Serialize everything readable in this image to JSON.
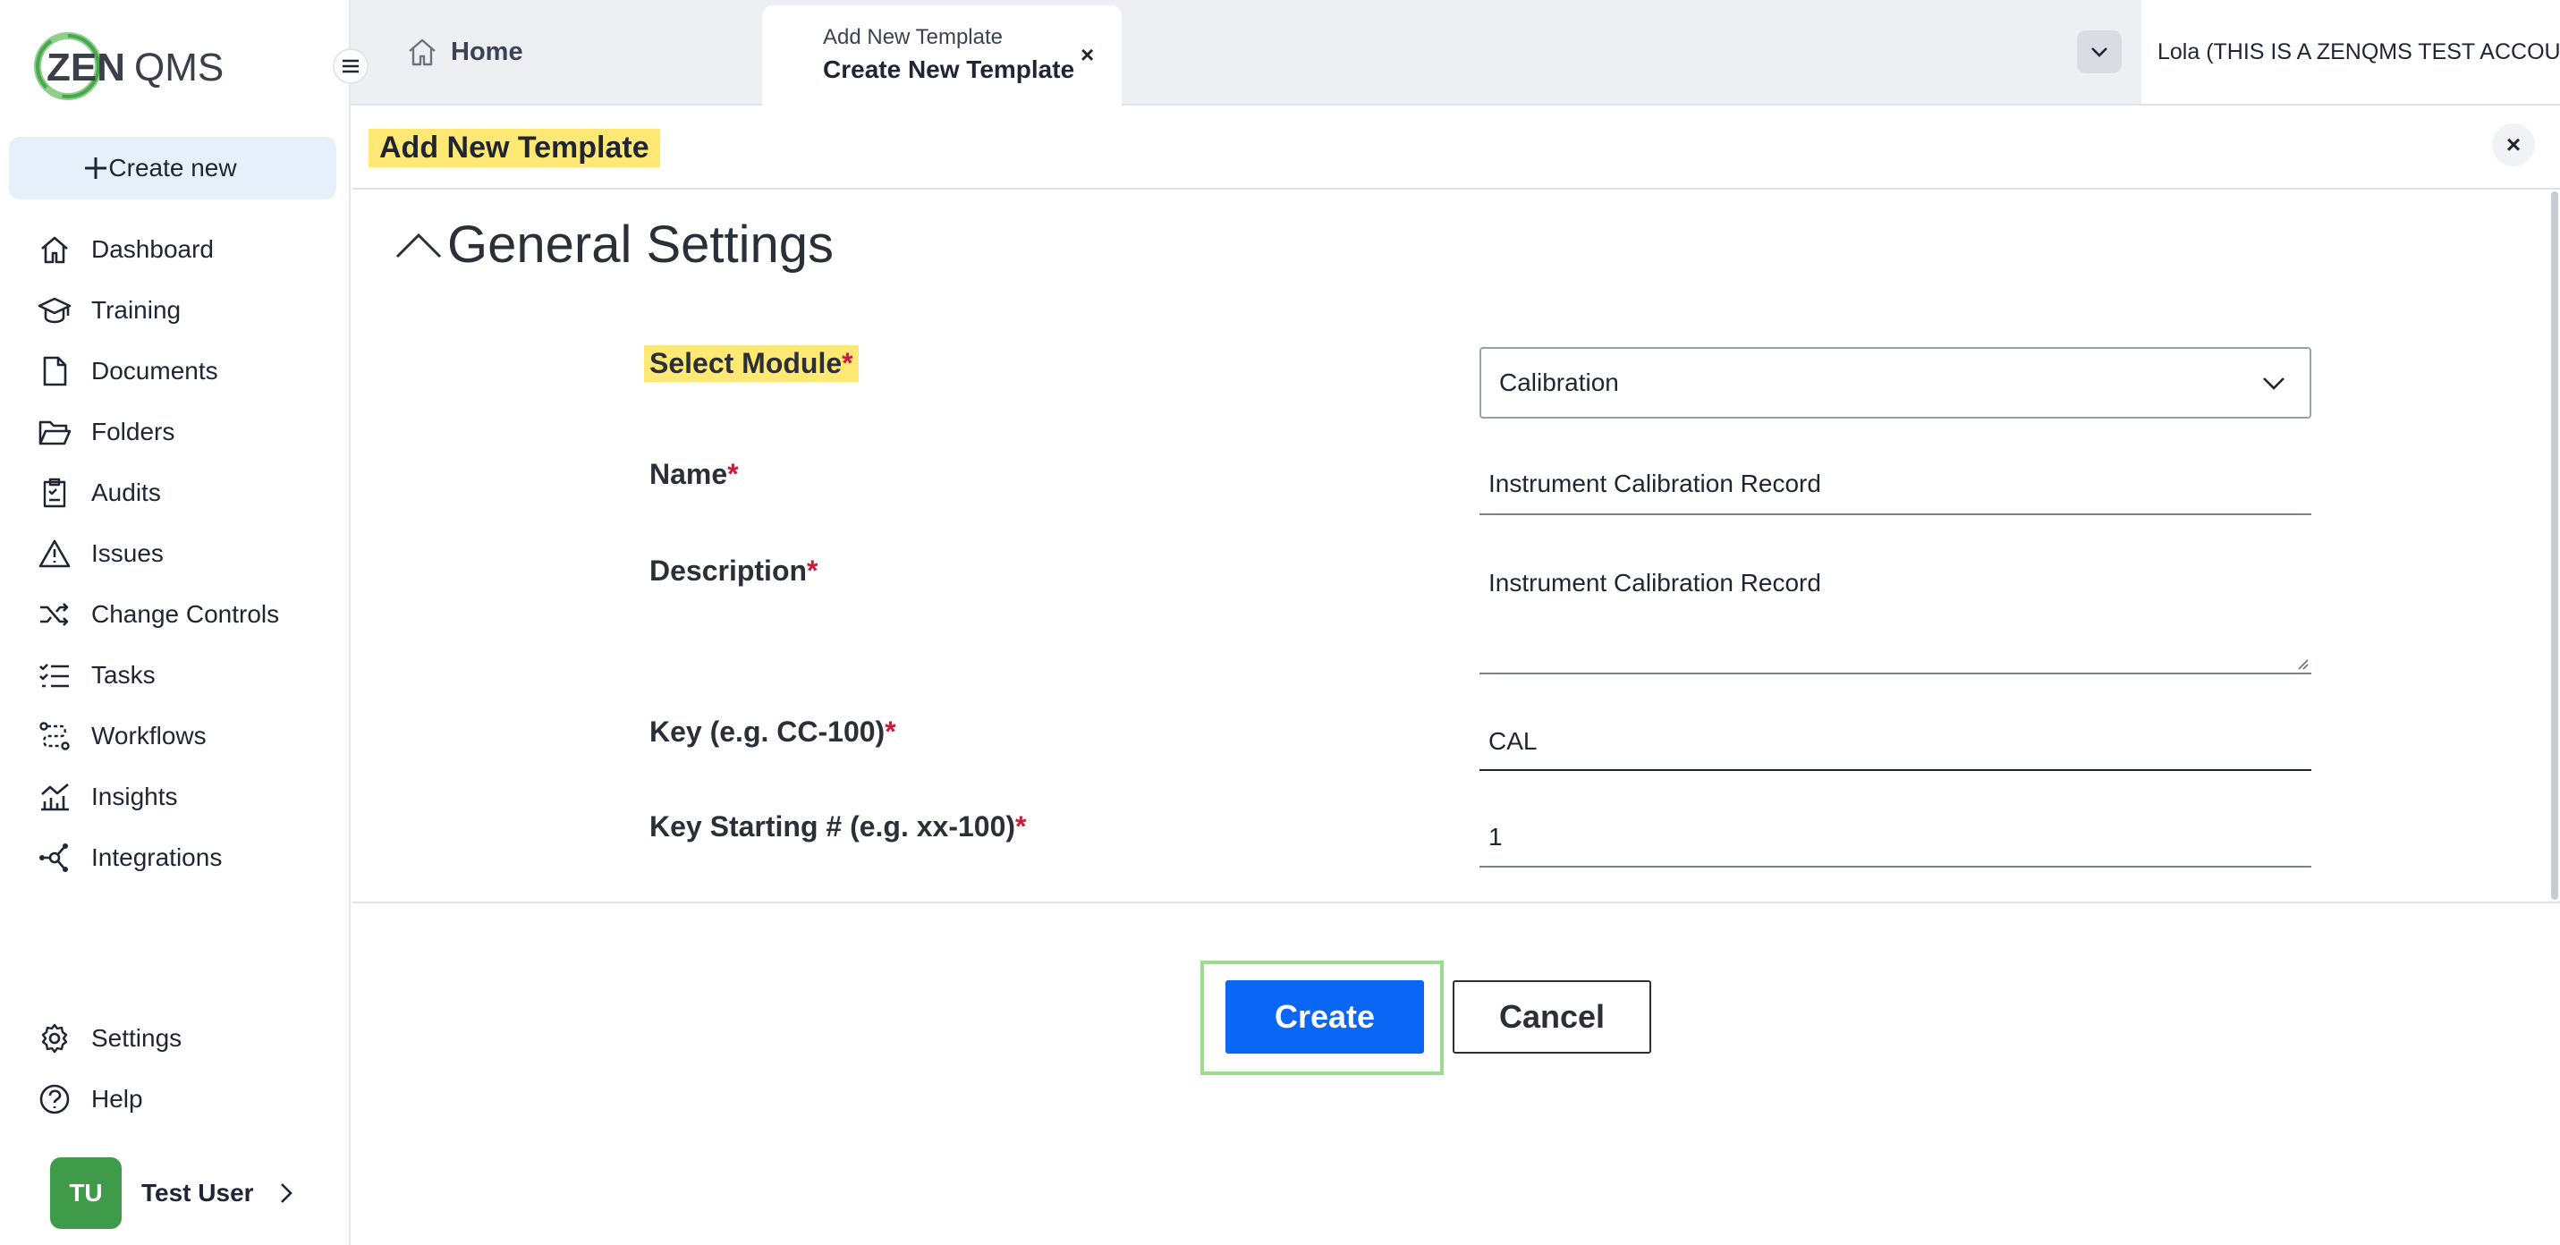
{
  "brand": {
    "logo_text": "ZENQMS",
    "accent_color": "#0a66f5",
    "logo_green": "#49a84f"
  },
  "sidebar": {
    "create_label": "Create new",
    "items": [
      {
        "label": "Dashboard",
        "icon": "home-icon"
      },
      {
        "label": "Training",
        "icon": "graduation-cap-icon"
      },
      {
        "label": "Documents",
        "icon": "document-icon"
      },
      {
        "label": "Folders",
        "icon": "folder-open-icon"
      },
      {
        "label": "Audits",
        "icon": "clipboard-check-icon"
      },
      {
        "label": "Issues",
        "icon": "warning-triangle-icon"
      },
      {
        "label": "Change Controls",
        "icon": "shuffle-icon"
      },
      {
        "label": "Tasks",
        "icon": "list-check-icon"
      },
      {
        "label": "Workflows",
        "icon": "workflow-icon"
      },
      {
        "label": "Insights",
        "icon": "chart-icon"
      },
      {
        "label": "Integrations",
        "icon": "network-icon"
      }
    ],
    "bottom_items": [
      {
        "label": "Settings",
        "icon": "gear-icon"
      },
      {
        "label": "Help",
        "icon": "help-circle-icon"
      }
    ],
    "user": {
      "initials": "TU",
      "name": "Test User"
    }
  },
  "topbar": {
    "home_label": "Home",
    "active_tab": {
      "subtitle": "Add New Template",
      "title": "Create New Template",
      "close": "×"
    },
    "account_label": "Lola (THIS IS A ZENQMS TEST ACCOUNT)"
  },
  "page": {
    "title": "Add New Template",
    "close": "×",
    "section_title": "General Settings"
  },
  "form": {
    "module": {
      "label": "Select Module",
      "value": "Calibration"
    },
    "name": {
      "label": "Name",
      "value": "Instrument Calibration Record"
    },
    "description": {
      "label": "Description",
      "value": "Instrument Calibration Record"
    },
    "key": {
      "label": "Key (e.g. CC-100)",
      "value": "CAL"
    },
    "key_start": {
      "label": "Key Starting # (e.g. xx-100)",
      "value": "1"
    },
    "required_mark": "*"
  },
  "actions": {
    "create_label": "Create",
    "cancel_label": "Cancel"
  }
}
